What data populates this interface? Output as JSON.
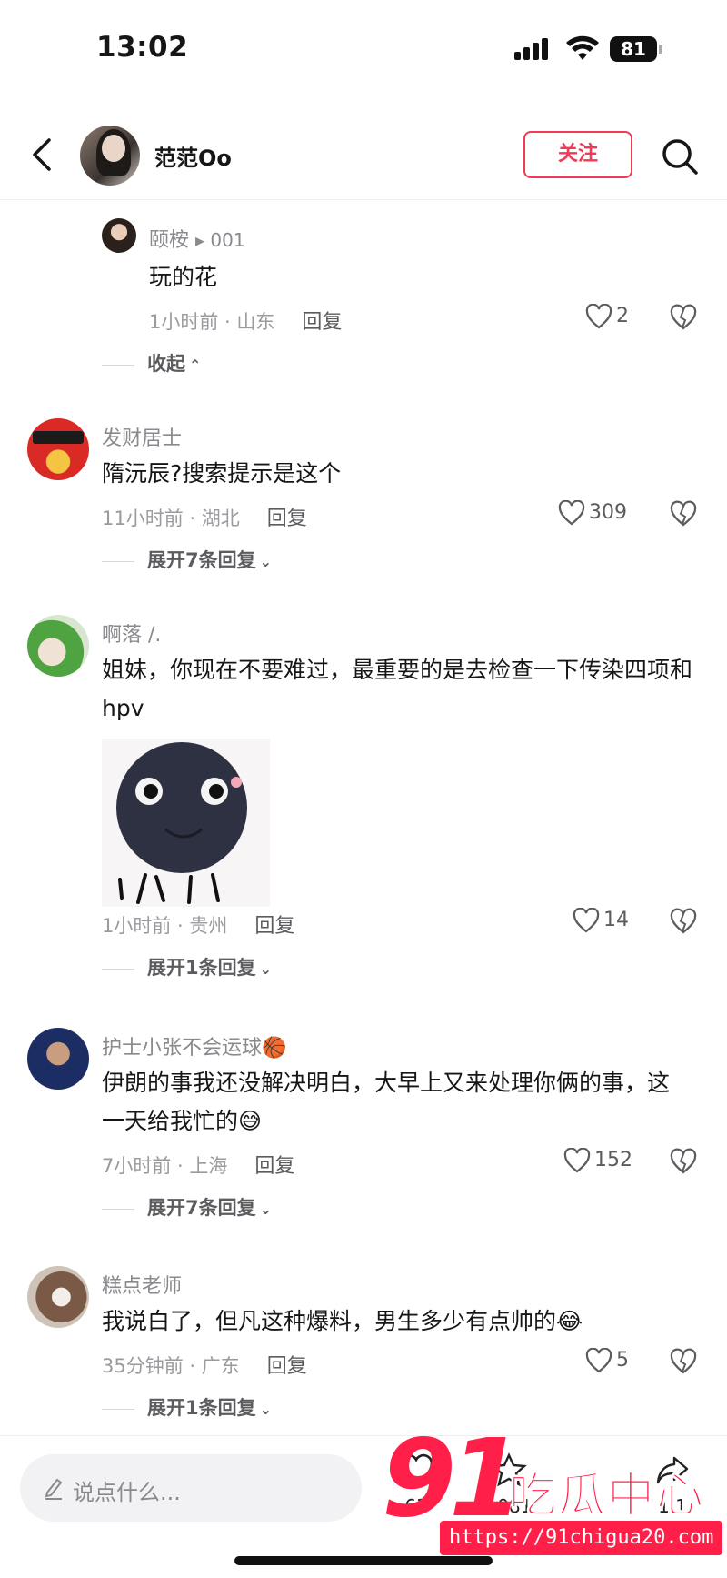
{
  "status_bar": {
    "time": "13:02",
    "battery": "81"
  },
  "header": {
    "name": "范范Oo",
    "follow_label": "关注"
  },
  "comments": [
    {
      "user": "颐桉",
      "reply_to": "001",
      "text": "玩的花",
      "time_location": "1小时前 · 山东",
      "reply_label": "回复",
      "likes": "2",
      "collapse_label": "收起"
    },
    {
      "user": "发财居士",
      "text": "隋沅辰?搜索提示是这个",
      "time_location": "11小时前 · 湖北",
      "reply_label": "回复",
      "likes": "309",
      "expand_label": "展开7条回复"
    },
    {
      "user": "啊落 /.",
      "text": "姐妹，你现在不要难过，最重要的是去检查一下传染四项和 hpv",
      "time_location": "1小时前 · 贵州",
      "reply_label": "回复",
      "likes": "14",
      "expand_label": "展开1条回复"
    },
    {
      "user": "护士小张不会运球🏀",
      "text": "伊朗的事我还没解决明白，大早上又来处理你俩的事，这一天给我忙的😅",
      "time_location": "7小时前 · 上海",
      "reply_label": "回复",
      "likes": "152",
      "expand_label": "展开7条回复"
    },
    {
      "user": "糕点老师",
      "text": "我说白了，但凡这种爆料，男生多少有点帅的😂",
      "time_location": "35分钟前 · 广东",
      "reply_label": "回复",
      "likes": "5",
      "expand_label": "展开1条回复"
    }
  ],
  "sticker_icon": "moon-face-sticker",
  "bottom_bar": {
    "placeholder": "说点什么...",
    "counts": [
      "63",
      "1081",
      "1.1"
    ]
  },
  "watermark": {
    "number": "91",
    "brand": "吃瓜中心",
    "url": "https://91chigua20.com"
  },
  "colors": {
    "accent": "#f23a55",
    "watermark": "#ff1f48"
  }
}
